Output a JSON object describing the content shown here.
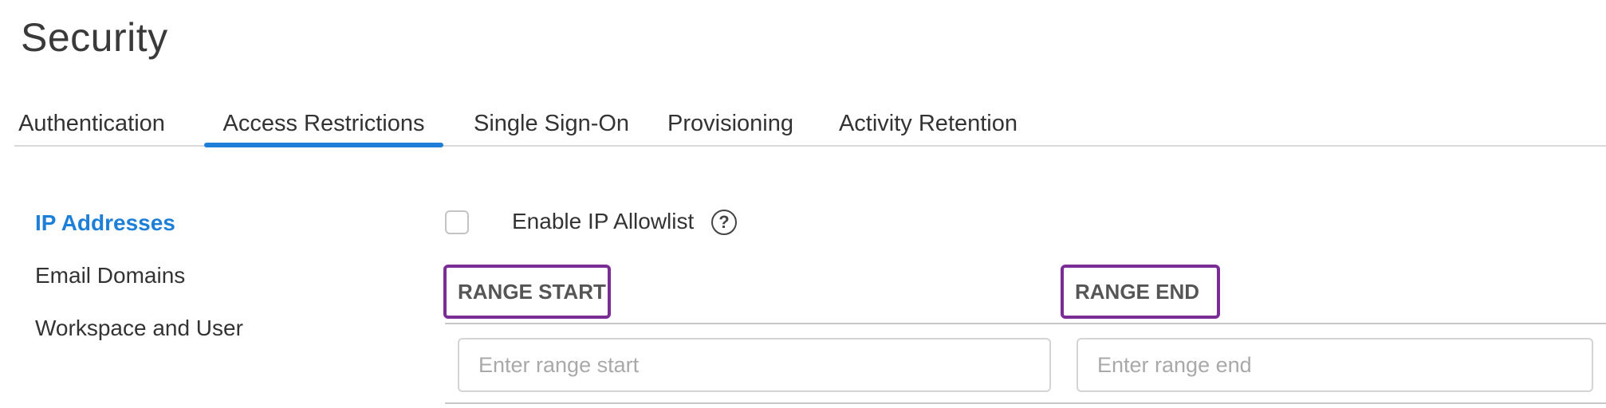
{
  "page": {
    "title": "Security"
  },
  "tabs": [
    {
      "label": "Authentication",
      "active": false
    },
    {
      "label": "Access Restrictions",
      "active": true
    },
    {
      "label": "Single Sign-On",
      "active": false
    },
    {
      "label": "Provisioning",
      "active": false
    },
    {
      "label": "Activity Retention",
      "active": false
    }
  ],
  "sidebar": {
    "items": [
      {
        "label": "IP Addresses",
        "active": true
      },
      {
        "label": "Email Domains",
        "active": false
      },
      {
        "label": "Workspace and User",
        "active": false
      }
    ]
  },
  "ip_allowlist": {
    "enable_label": "Enable IP Allowlist",
    "enabled": false,
    "help_glyph": "?",
    "columns": {
      "start_header": "RANGE START",
      "end_header": "RANGE END"
    },
    "inputs": {
      "start_value": "",
      "start_placeholder": "Enter range start",
      "end_value": "",
      "end_placeholder": "Enter range end"
    }
  },
  "colors": {
    "accent": "#1e7fd8",
    "highlight_box": "#7b2d96",
    "divider": "#d9d9d9"
  },
  "icons": {
    "help": "question-circle-icon",
    "checkbox": "checkbox-unchecked"
  }
}
